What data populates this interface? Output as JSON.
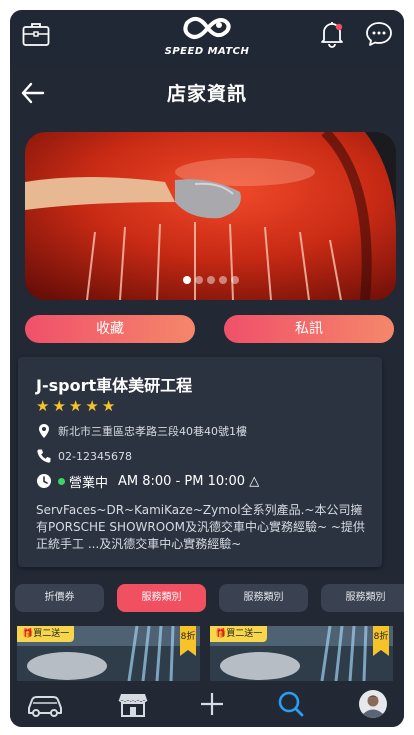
{
  "header": {
    "brand": "SPEED MATCH",
    "icons": {
      "left": "briefcase-icon",
      "bell": "bell-icon",
      "chat": "chat-icon"
    },
    "has_notification": true
  },
  "page": {
    "title": "店家資訊"
  },
  "banner": {
    "slides": 5,
    "active": 0
  },
  "actions": {
    "favorite": "收藏",
    "message": "私訊"
  },
  "store": {
    "name": "J-sport車体美研工程",
    "rating": 5,
    "address": "新北市三重區忠孝路三段40巷40號1樓",
    "phone": "02-12345678",
    "status": "營業中",
    "hours": "AM 8:00 - PM 10:00 △",
    "description": "ServFaces~DR~KamiKaze~Zymol全系列產品.~本公司擁有PORSCHE SHOWROOM及汎德交車中心實務經驗~ ~提供正統手工 ...及汎德交車中心實務經驗~"
  },
  "tabs": [
    "折價券",
    "服務類別",
    "服務類別",
    "服務類別"
  ],
  "active_tab": 1,
  "promos": [
    {
      "badge": "買二送一",
      "discount": "8折"
    },
    {
      "badge": "買二送一",
      "discount": "8折"
    }
  ],
  "nav": [
    "car-icon",
    "store-icon",
    "plus-icon",
    "search-icon",
    "avatar"
  ],
  "colors": {
    "accent": "#f05060",
    "star": "#f6c32a",
    "active_nav": "#2a9df4",
    "background": "#222935"
  }
}
